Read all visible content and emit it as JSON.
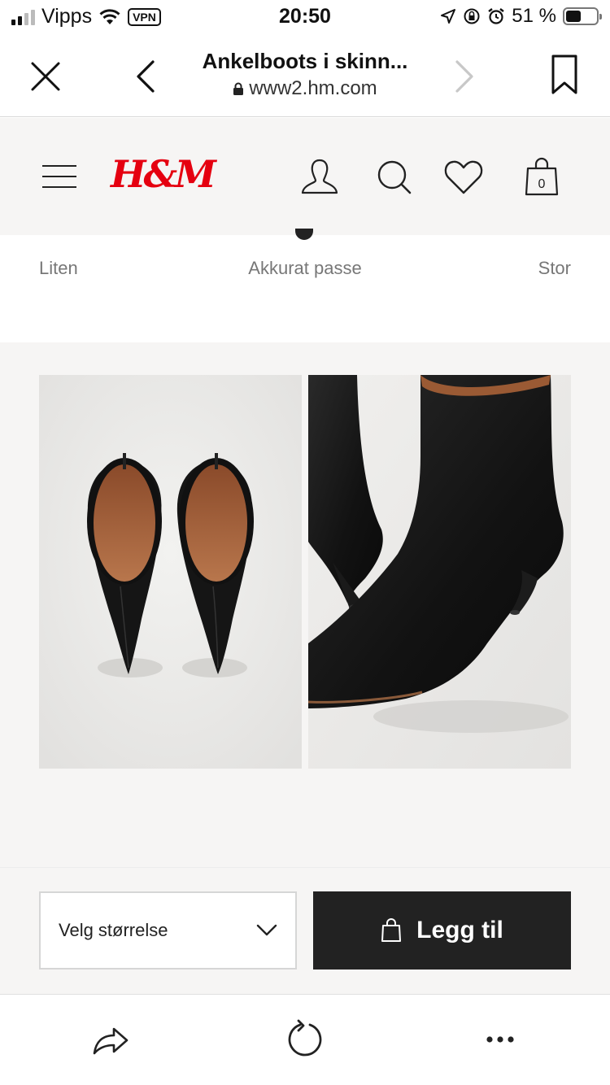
{
  "status_bar": {
    "carrier": "Vipps",
    "vpn": "VPN",
    "time": "20:50",
    "battery": "51 %",
    "battery_level": 0.51,
    "icons": [
      "signal-icon",
      "wifi-icon",
      "location-icon",
      "orientation-lock-icon",
      "alarm-icon",
      "battery-icon"
    ]
  },
  "browser": {
    "title": "Ankelboots i skinn...",
    "url": "www2.hm.com",
    "icons": [
      "close-icon",
      "back-icon",
      "forward-icon",
      "bookmark-icon",
      "lock-icon"
    ]
  },
  "header": {
    "logo": "H&M",
    "cart_count": "0",
    "icons": [
      "menu-icon",
      "account-icon",
      "search-icon",
      "heart-icon",
      "bag-icon"
    ]
  },
  "fit": {
    "small": "Liten",
    "just_right": "Akkurat passe",
    "large": "Stor"
  },
  "gallery": {
    "images": [
      "boots-top-view",
      "boot-side-closeup"
    ]
  },
  "action_bar": {
    "size_placeholder": "Velg størrelse",
    "add_label": "Legg til",
    "icons": [
      "chevron-down-icon",
      "shopping-bag-icon"
    ]
  },
  "toolbar": {
    "icons": [
      "share-icon",
      "reload-icon",
      "more-icon"
    ]
  },
  "colors": {
    "brand_red": "#e50010",
    "button_dark": "#222222",
    "page_bg": "#f6f5f4"
  }
}
